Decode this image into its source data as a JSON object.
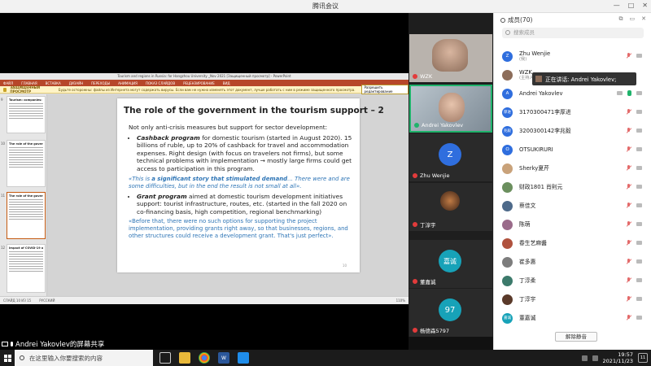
{
  "window": {
    "title": "腾讯会议",
    "controls": [
      "—",
      "□",
      "✕"
    ]
  },
  "ppt": {
    "title_bar": "Tourism and regions in Russia: for Hangzhou University _Nov 2021 [Защищенный просмотр] - PowerPoint",
    "tabs": [
      "ФАЙЛ",
      "ГЛАВНАЯ",
      "ВСТАВКА",
      "ДИЗАЙН",
      "ПЕРЕХОДЫ",
      "АНИМАЦИЯ",
      "ПОКАЗ СЛАЙДОВ",
      "РЕЦЕНЗИРОВАНИЕ",
      "ВИД"
    ],
    "protected_view": {
      "badge": "ЗАЩИЩЕННЫЙ ПРОСМОТР",
      "text": "Будьте осторожны: файлы из Интернета могут содержать вирусы. Если вам не нужно изменять этот документ, лучше работать с ним в режиме защищенного просмотра.",
      "button": "Разрешить редактирование"
    },
    "thumbnails": [
      {
        "num": "9",
        "title": "Tourism: companies: what is in"
      },
      {
        "num": "10",
        "title": "The role of the government in the tourism support – 1"
      },
      {
        "num": "11",
        "title": "The role of the government in the tourism support – 2"
      },
      {
        "num": "12",
        "title": "Impact of COVID-19 on Russian tourism industry"
      }
    ],
    "status": {
      "slide": "СЛАЙД 10 ИЗ 15",
      "lang": "РУССКИЙ",
      "zoom": "110%"
    }
  },
  "slide": {
    "title": "The role of the government in the tourism support – 2",
    "intro": "Not only anti-crisis measures but support for sector development:",
    "bullet1_lead": "Cashback program",
    "bullet1_text": " for domestic tourism (started in August 2020). 15 billions of ruble, up to 20% of cashback for travel and accommodation expenses. Right design (with focus on travelers not firms), but some technical problems with implementation → mostly large firms could get access to participation in this program.",
    "quote1_start": "«This is ",
    "quote1_bold": "a significant story that stimulated demand",
    "quote1_end": "… There were and are some difficulties, but in the end the result is not small at all».",
    "bullet2_lead": "Grant program",
    "bullet2_text": " aimed at domestic tourism development initiatives support: tourist infrastructure, routes, etc. (started in the fall 2020 on co-financing basis, high competition, regional benchmarking)",
    "quote2": "«Before that, there were no such options for supporting the project implementation, providing grants right away, so that businesses, regions, and other structures could receive a development grant. That's just perfect».",
    "page": "10"
  },
  "share_label": "Andrei Yakovlev的屏幕共享",
  "video_tiles": [
    {
      "name": "WZK",
      "type": "face",
      "active": false
    },
    {
      "name": "Andrei Yakovlev",
      "type": "face2",
      "active": true
    },
    {
      "name": "Zhu Wenjie",
      "type": "letter",
      "letter": "Z",
      "color": "#2f6ede",
      "active": false
    },
    {
      "name": "丁淳宇",
      "type": "photo",
      "active": false
    },
    {
      "name": "董嘉诚",
      "type": "letter",
      "letter": "嘉诚",
      "color": "#17a2b8",
      "active": false
    },
    {
      "name": "杨德森5797",
      "type": "letter",
      "letter": "97",
      "color": "#17a2b8",
      "active": false
    }
  ],
  "panel": {
    "header": "成员(70)",
    "search_placeholder": "搜索成员",
    "speaking_tooltip": "正在讲话: Andrei Yakovlev;",
    "unmute_all": "解除静音",
    "members": [
      {
        "name": "Zhu Wenjie",
        "sub": "(我)",
        "avatar": "Z",
        "color": "#2f6ede"
      },
      {
        "name": "WZK",
        "sub": "(主持人)",
        "avatar": "",
        "color": "#8c6d5a"
      },
      {
        "name": "Andrei Yakovlev",
        "sub": "",
        "avatar": "A",
        "color": "#2f6ede"
      },
      {
        "name": "3170300471李厚进",
        "sub": "",
        "avatar": "厚进",
        "color": "#2f6ede"
      },
      {
        "name": "3200300142李兆毅",
        "sub": "",
        "avatar": "兆毅",
        "color": "#2f6ede"
      },
      {
        "name": "OTSUKIRURI",
        "sub": "",
        "avatar": "O",
        "color": "#2f6ede"
      },
      {
        "name": "Sherky夏芹",
        "sub": "",
        "avatar": "",
        "color": "#c9a27a"
      },
      {
        "name": "财政1801 肖則元",
        "sub": "",
        "avatar": "",
        "color": "#6b8f5e"
      },
      {
        "name": "蔡佳文",
        "sub": "",
        "avatar": "",
        "color": "#4e6a8a"
      },
      {
        "name": "陈萌",
        "sub": "",
        "avatar": "",
        "color": "#9a6b8a"
      },
      {
        "name": "春生艺麻醬",
        "sub": "",
        "avatar": "",
        "color": "#b0523e"
      },
      {
        "name": "崔多惠",
        "sub": "",
        "avatar": "",
        "color": "#7d7d7d"
      },
      {
        "name": "丁淳柔",
        "sub": "",
        "avatar": "",
        "color": "#3c7a6b"
      },
      {
        "name": "丁淳宇",
        "sub": "",
        "avatar": "",
        "color": "#5a3a2a"
      },
      {
        "name": "董嘉诚",
        "sub": "",
        "avatar": "嘉诚",
        "color": "#17a2b8"
      }
    ]
  },
  "taskbar": {
    "search_placeholder": "在这里输入你要搜索的内容",
    "time": "19:57",
    "date": "2021/11/23",
    "notifications": "11"
  }
}
